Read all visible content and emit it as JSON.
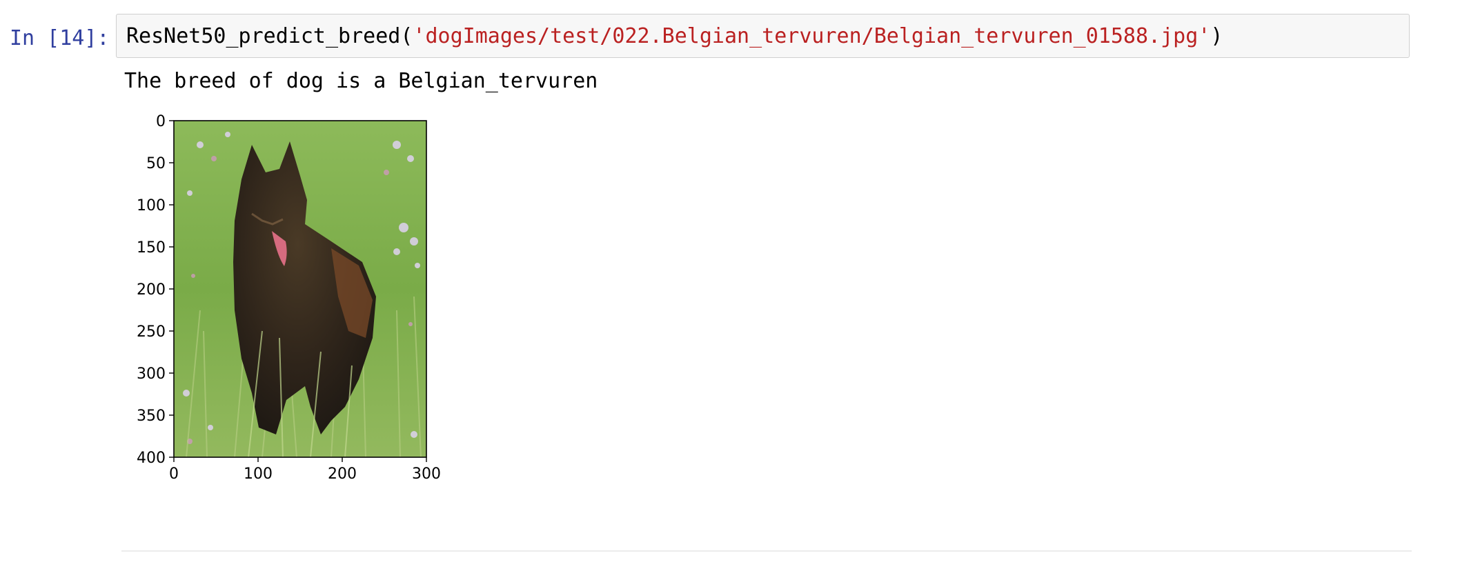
{
  "cell": {
    "prompt": "In [14]:",
    "code_function": "ResNet50_predict_breed(",
    "code_string": "'dogImages/test/022.Belgian_tervuren/Belgian_tervuren_01588.jpg'",
    "code_close": ")"
  },
  "output": {
    "stdout": "The breed of dog is a Belgian_tervuren"
  },
  "chart_data": {
    "type": "image",
    "xlim": [
      0,
      300
    ],
    "ylim": [
      400,
      0
    ],
    "x_ticks": [
      0,
      100,
      200,
      300
    ],
    "y_ticks": [
      0,
      50,
      100,
      150,
      200,
      250,
      300,
      350,
      400
    ],
    "grid": false
  },
  "colors": {
    "prompt": "#303f9f",
    "string": "#ba2121",
    "cell_background": "#f7f7f7",
    "cell_border": "#cfcfcf"
  }
}
